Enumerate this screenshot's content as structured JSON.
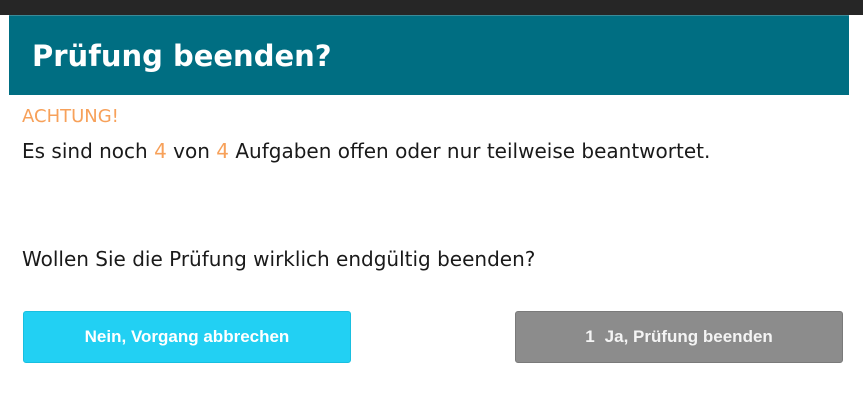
{
  "dialog": {
    "title": "Prüfung beenden?",
    "warning_label": "ACHTUNG!",
    "message": {
      "prefix": "Es sind noch ",
      "open_count": "4",
      "middle": " von ",
      "total_count": "4",
      "suffix": " Aufgaben offen oder nur teilweise beantwortet."
    },
    "question": "Wollen Sie die Prüfung wirklich endgültig beenden?",
    "cancel_button": {
      "label": "Nein, Vorgang abbrechen"
    },
    "confirm_button": {
      "counter": "1",
      "label": "Ja, Prüfung beenden"
    }
  },
  "colors": {
    "header": "#006e82",
    "accent_warning": "#f7a15a",
    "cancel_button": "#22d0f3",
    "confirm_button": "#8c8c8c",
    "top_bar": "#262626"
  }
}
